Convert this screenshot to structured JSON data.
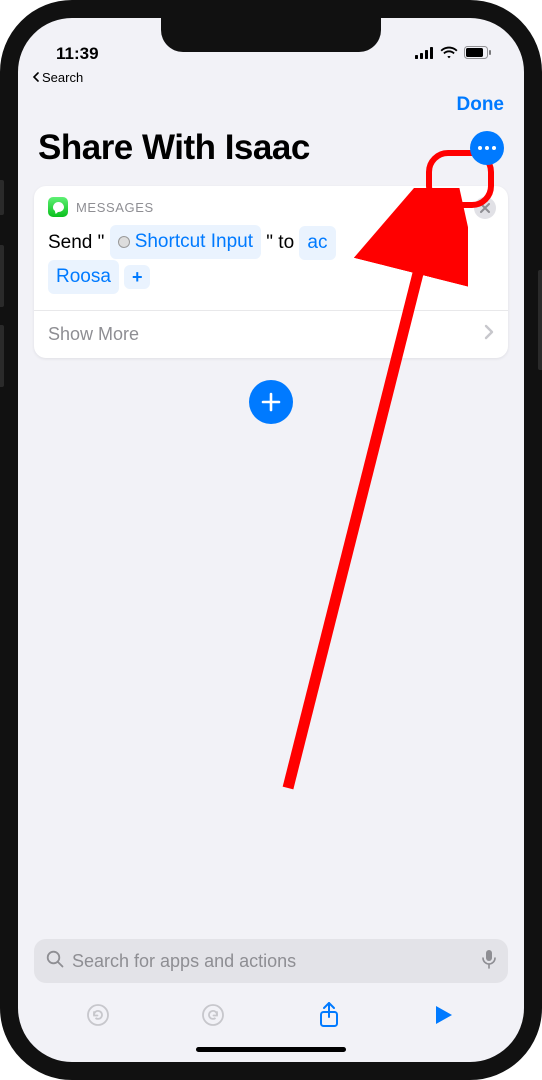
{
  "status": {
    "time": "11:39",
    "back_label": "Search"
  },
  "nav": {
    "done_label": "Done"
  },
  "title": "Share With Isaac",
  "action": {
    "app_label": "MESSAGES",
    "prefix": "Send \"",
    "token_label": "Shortcut Input",
    "midfix": "\" to",
    "recipient_first_part": "ac",
    "recipient_second_line": "Roosa",
    "show_more_label": "Show More"
  },
  "search": {
    "placeholder": "Search for apps and actions"
  }
}
